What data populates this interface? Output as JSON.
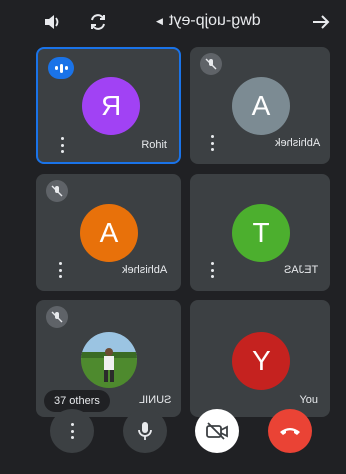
{
  "header": {
    "meeting_code": "dwg-uojp-eyt",
    "icons": [
      "back-arrow-icon",
      "chevron-down-icon",
      "switch-camera-icon",
      "audio-output-icon"
    ]
  },
  "tiles": [
    {
      "name": "Rohit",
      "initial": "R",
      "avatar_color": "#a142f4",
      "state": "speaking",
      "active": true
    },
    {
      "name": "Abhishek",
      "initial": "A",
      "avatar_color": "#7c8b93",
      "state": "muted",
      "active": false
    },
    {
      "name": "Abhishek",
      "initial": "A",
      "avatar_color": "#e8710a",
      "state": "muted",
      "active": false
    },
    {
      "name": "TEJAS",
      "initial": "T",
      "avatar_color": "#4caf2e",
      "state": "unmuted",
      "active": false
    },
    {
      "name": "SUNIL",
      "others_label": "37 others",
      "state": "muted",
      "has_photo": true,
      "active": false
    },
    {
      "name": "You",
      "initial": "Y",
      "avatar_color": "#c5221f",
      "state": "unmuted",
      "active": false
    }
  ],
  "controls": {
    "end_call_color": "#ea4335",
    "camera_off_bg": "#ffffff",
    "icons": [
      "more-options-icon",
      "microphone-icon",
      "camera-off-icon",
      "end-call-icon"
    ]
  }
}
